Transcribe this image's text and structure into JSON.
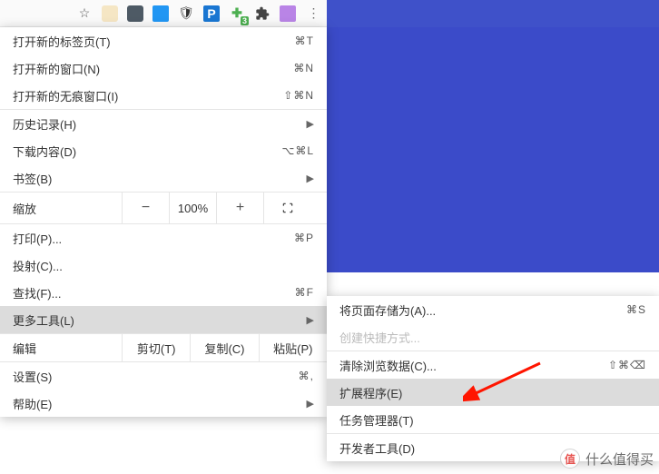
{
  "toolbar": {
    "star": "☆",
    "badge_count": "3",
    "puzzle": "✦",
    "dots": "⋮",
    "ext_p_label": "P",
    "ext_shield": "🛡"
  },
  "menu": {
    "new_tab": {
      "label": "打开新的标签页(T)",
      "shortcut": "⌘T"
    },
    "new_window": {
      "label": "打开新的窗口(N)",
      "shortcut": "⌘N"
    },
    "incognito": {
      "label": "打开新的无痕窗口(I)",
      "shortcut": "⇧⌘N"
    },
    "history": {
      "label": "历史记录(H)"
    },
    "downloads": {
      "label": "下载内容(D)",
      "shortcut": "⌥⌘L"
    },
    "bookmarks": {
      "label": "书签(B)"
    },
    "zoom": {
      "label": "缩放",
      "minus": "−",
      "value": "100%",
      "plus": "+"
    },
    "print": {
      "label": "打印(P)...",
      "shortcut": "⌘P"
    },
    "cast": {
      "label": "投射(C)..."
    },
    "find": {
      "label": "查找(F)...",
      "shortcut": "⌘F"
    },
    "more_tools": {
      "label": "更多工具(L)"
    },
    "edit": {
      "label": "编辑",
      "cut": "剪切(T)",
      "copy": "复制(C)",
      "paste": "粘贴(P)"
    },
    "settings": {
      "label": "设置(S)",
      "shortcut": "⌘,"
    },
    "help": {
      "label": "帮助(E)"
    }
  },
  "submenu": {
    "save_page": {
      "label": "将页面存储为(A)...",
      "shortcut": "⌘S"
    },
    "create_shortcut": {
      "label": "创建快捷方式..."
    },
    "clear_data": {
      "label": "清除浏览数据(C)...",
      "shortcut": "⇧⌘⌫"
    },
    "extensions": {
      "label": "扩展程序(E)"
    },
    "task_manager": {
      "label": "任务管理器(T)"
    },
    "dev_tools": {
      "label": "开发者工具(D)"
    }
  },
  "watermark": {
    "char": "值",
    "text": "什么值得买"
  }
}
